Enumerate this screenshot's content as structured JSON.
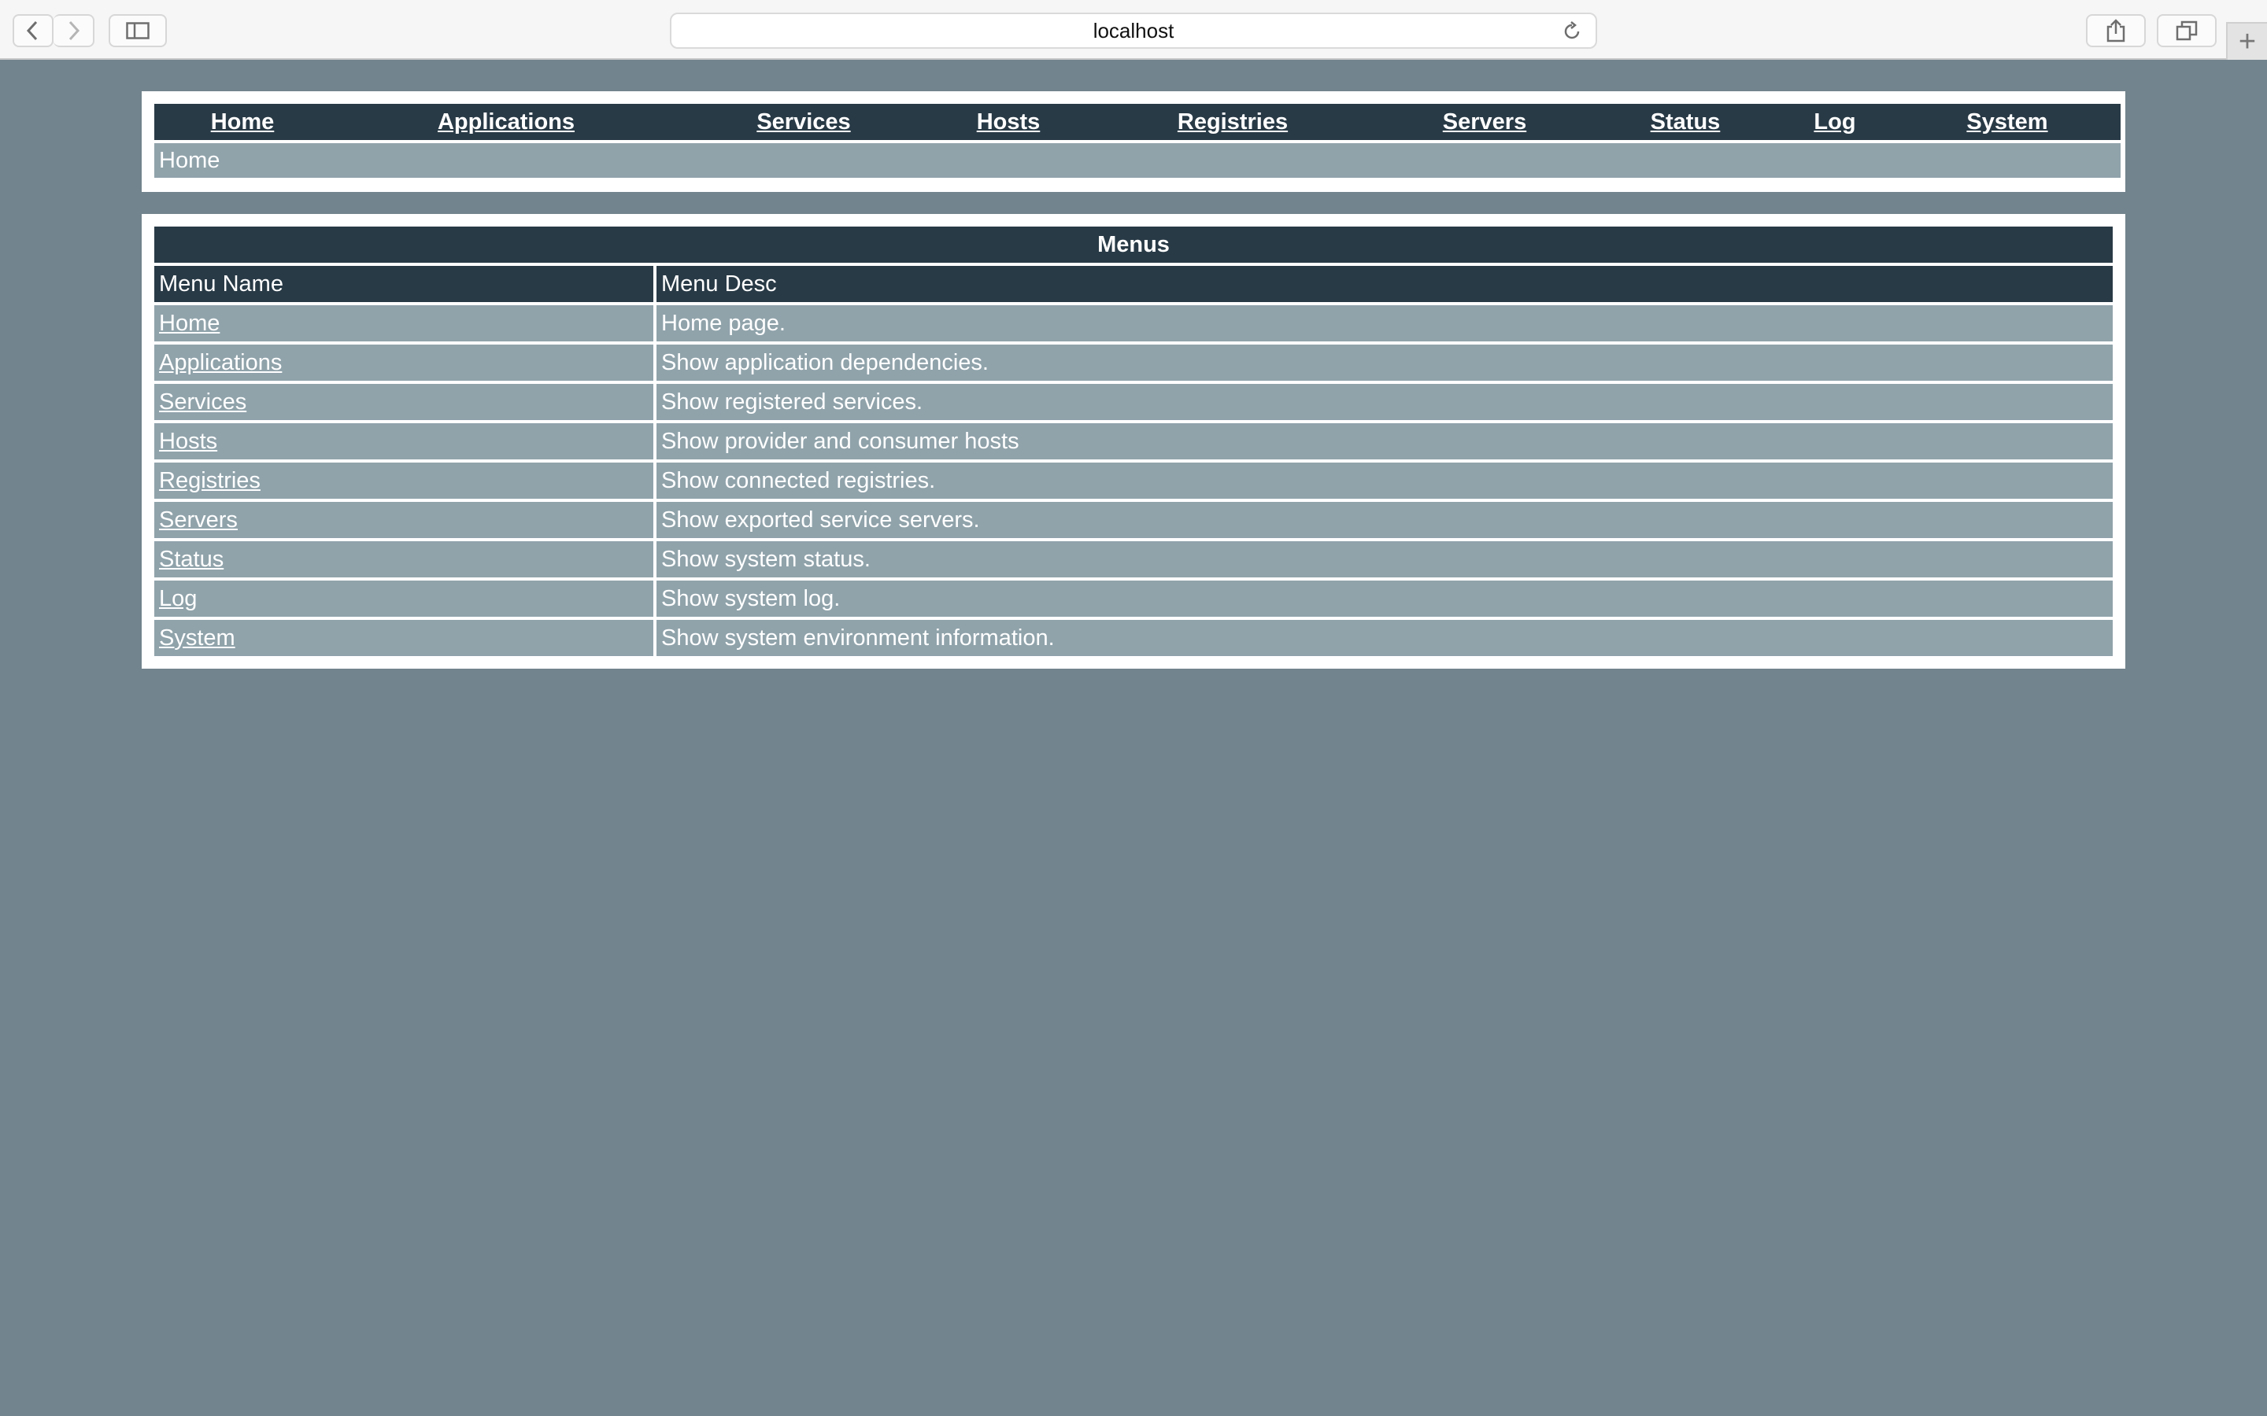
{
  "browser": {
    "url": "localhost"
  },
  "nav": {
    "items": [
      {
        "label": "Home"
      },
      {
        "label": "Applications"
      },
      {
        "label": "Services"
      },
      {
        "label": "Hosts"
      },
      {
        "label": "Registries"
      },
      {
        "label": "Servers"
      },
      {
        "label": "Status"
      },
      {
        "label": "Log"
      },
      {
        "label": "System"
      }
    ],
    "breadcrumb": "Home"
  },
  "menus": {
    "title": "Menus",
    "columns": [
      "Menu Name",
      "Menu Desc"
    ],
    "rows": [
      {
        "name": "Home",
        "desc": "Home page."
      },
      {
        "name": "Applications",
        "desc": "Show application dependencies."
      },
      {
        "name": "Services",
        "desc": "Show registered services."
      },
      {
        "name": "Hosts",
        "desc": "Show provider and consumer hosts"
      },
      {
        "name": "Registries",
        "desc": "Show connected registries."
      },
      {
        "name": "Servers",
        "desc": "Show exported service servers."
      },
      {
        "name": "Status",
        "desc": "Show system status."
      },
      {
        "name": "Log",
        "desc": "Show system log."
      },
      {
        "name": "System",
        "desc": "Show system environment information."
      }
    ]
  },
  "colors": {
    "page_bg": "#72848d",
    "header_bg": "#283a46",
    "row_bg": "#90a3ab"
  }
}
